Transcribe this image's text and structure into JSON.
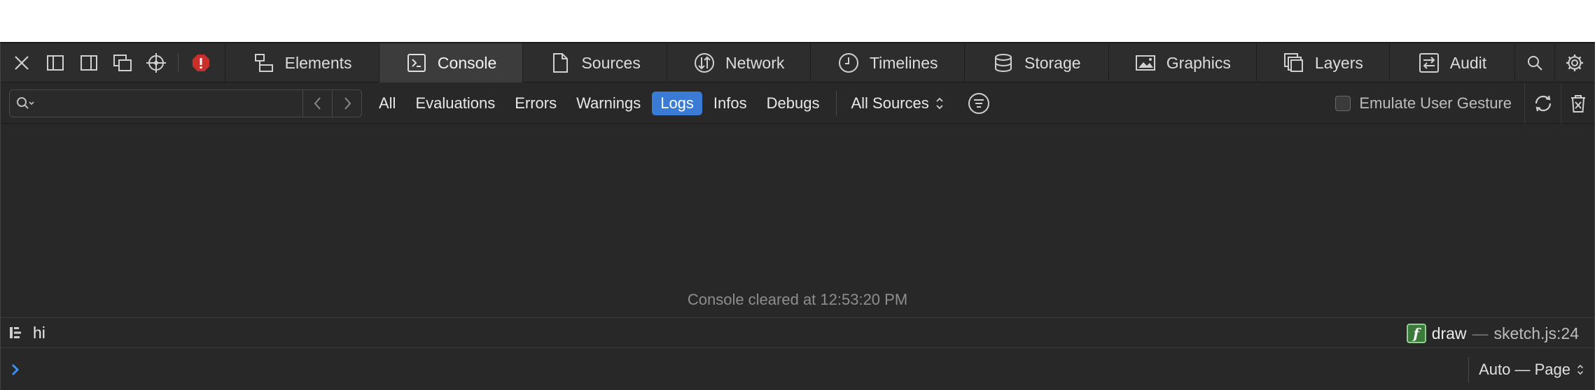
{
  "toolbar": {
    "icons": [
      "close-icon",
      "dock-left-icon",
      "dock-right-icon",
      "detach-window-icon",
      "inspect-crosshair-icon",
      "error-indicator-icon"
    ]
  },
  "tabs": [
    {
      "label": "Elements",
      "icon": "elements-icon",
      "active": false
    },
    {
      "label": "Console",
      "icon": "console-icon",
      "active": true
    },
    {
      "label": "Sources",
      "icon": "sources-icon",
      "active": false
    },
    {
      "label": "Network",
      "icon": "network-icon",
      "active": false
    },
    {
      "label": "Timelines",
      "icon": "timelines-icon",
      "active": false
    },
    {
      "label": "Storage",
      "icon": "storage-icon",
      "active": false
    },
    {
      "label": "Graphics",
      "icon": "graphics-icon",
      "active": false
    },
    {
      "label": "Layers",
      "icon": "layers-icon",
      "active": false
    },
    {
      "label": "Audit",
      "icon": "audit-icon",
      "active": false
    }
  ],
  "filter": {
    "search_value": "",
    "levels": [
      "All",
      "Evaluations",
      "Errors",
      "Warnings",
      "Logs",
      "Infos",
      "Debugs"
    ],
    "active_level": "Logs",
    "sources_label": "All Sources",
    "emulate_gesture_label": "Emulate User Gesture",
    "emulate_gesture_checked": false
  },
  "console": {
    "cleared_message": "Console cleared at 12:53:20 PM",
    "log": {
      "message": "hi",
      "function_name": "draw",
      "separator": "—",
      "location": "sketch.js:24"
    },
    "prompt_value": "",
    "execution_context": "Auto — Page"
  },
  "colors": {
    "accent": "#3a7bd5",
    "error": "#c9302c",
    "function_badge": "#3b7a3b",
    "background": "#282828"
  }
}
